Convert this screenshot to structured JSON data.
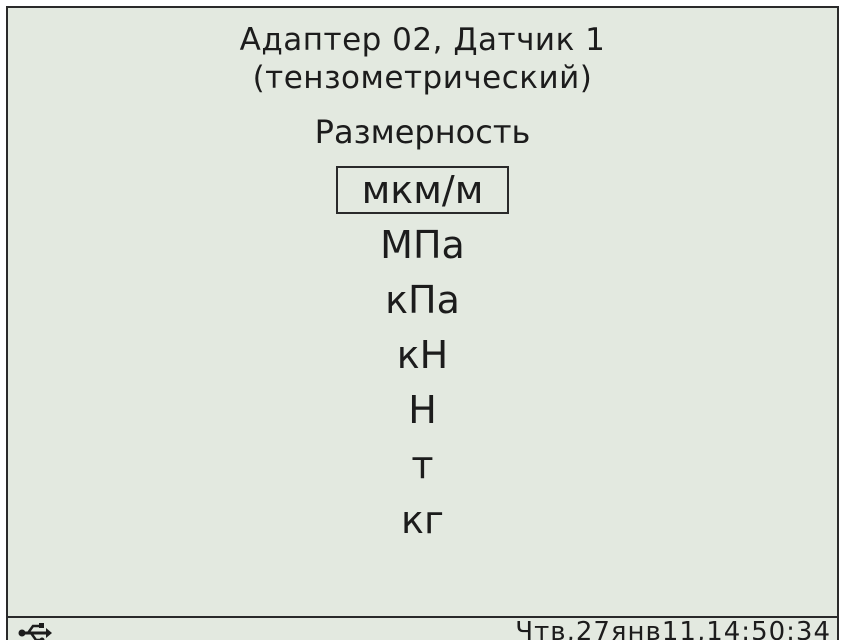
{
  "header": {
    "line1": "Адаптер 02, Датчик 1",
    "line2": "(тензометрический)"
  },
  "section": {
    "title": "Размерность"
  },
  "units": [
    {
      "label": "мкм/м",
      "selected": true
    },
    {
      "label": "МПа",
      "selected": false
    },
    {
      "label": "кПа",
      "selected": false
    },
    {
      "label": "кН",
      "selected": false
    },
    {
      "label": "Н",
      "selected": false
    },
    {
      "label": "т",
      "selected": false
    },
    {
      "label": "кг",
      "selected": false
    }
  ],
  "status_bar": {
    "icon": "usb-icon",
    "datetime": "Чтв,27янв11,14:50:34"
  },
  "colors": {
    "background": "#e3e9e0",
    "text": "#1c1c1c",
    "border": "#2a2a2a"
  }
}
